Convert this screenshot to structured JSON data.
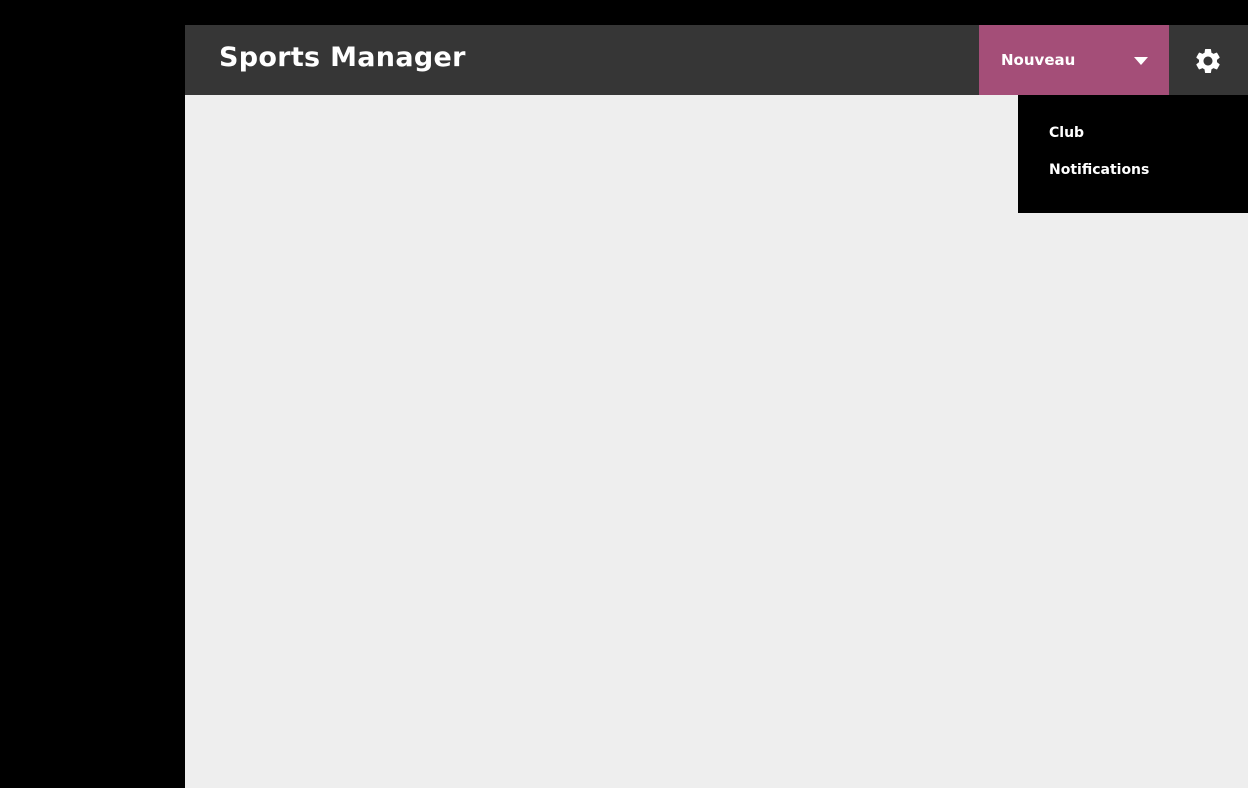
{
  "header": {
    "title": "Sports Manager"
  },
  "new_menu": {
    "label": "Nouveau",
    "icon": "chevron-down-icon",
    "items": [
      {
        "label": "Club"
      },
      {
        "label": "Notifications"
      }
    ]
  },
  "settings": {
    "icon": "gear-icon"
  },
  "colors": {
    "header_bg": "#363636",
    "accent": "#a44e78",
    "content_bg": "#eeeeee",
    "menu_bg": "#000000"
  }
}
